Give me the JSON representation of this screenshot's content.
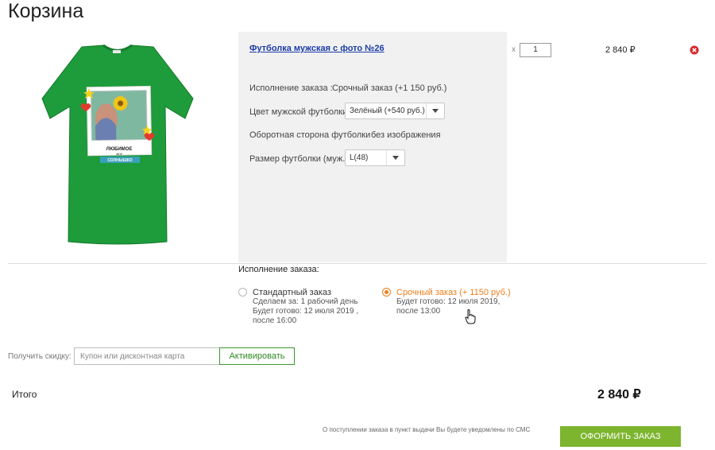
{
  "page": {
    "title": "Корзина"
  },
  "item": {
    "name": "Футболка мужская с фото №26",
    "image_caption": {
      "line1": "ЛЮБИМОЕ",
      "line2": "мое",
      "line3": "СОЛНЫШКО"
    },
    "options": [
      {
        "label": "Исполнение заказа :",
        "value": "Срочный заказ (+1 150 руб.)"
      },
      {
        "label": "Цвет мужской футболки",
        "select": "Зелёный (+540 руб.)"
      },
      {
        "label": "Оборотная сторона футболки :",
        "value": "без изображения"
      },
      {
        "label": "Размер футболки (муж.)",
        "select": "L(48)"
      }
    ],
    "qty_prefix": "x",
    "quantity": "1",
    "price": "2 840 ₽",
    "shirt_color": "#1e9b3a"
  },
  "execution": {
    "title": "Исполнение заказа:",
    "standard": {
      "title": "Стандартный заказ",
      "lines": [
        "Сделаем за: 1 рабочий день",
        "Будет готово: 12 июля 2019 ,",
        "после 16:00"
      ],
      "selected": false
    },
    "urgent": {
      "title": "Срочный заказ (+ 1150 руб.)",
      "lines": [
        "Будет готово: 12 июля 2019,",
        "после 13:00"
      ],
      "selected": true
    }
  },
  "coupon": {
    "label": "Получить скидку:",
    "placeholder": "Купон или дисконтная карта",
    "button": "Активировать"
  },
  "total": {
    "label": "Итого",
    "value": "2 840 ₽"
  },
  "notice": "О поступлении заказа в пункт выдачи Вы будете уведомлены по СМС",
  "order_button": "ОФОРМИТЬ ЗАКАЗ",
  "colors": {
    "accent_orange": "#f07f1a",
    "accent_green": "#7db52f",
    "link_blue": "#1a3ca8"
  }
}
